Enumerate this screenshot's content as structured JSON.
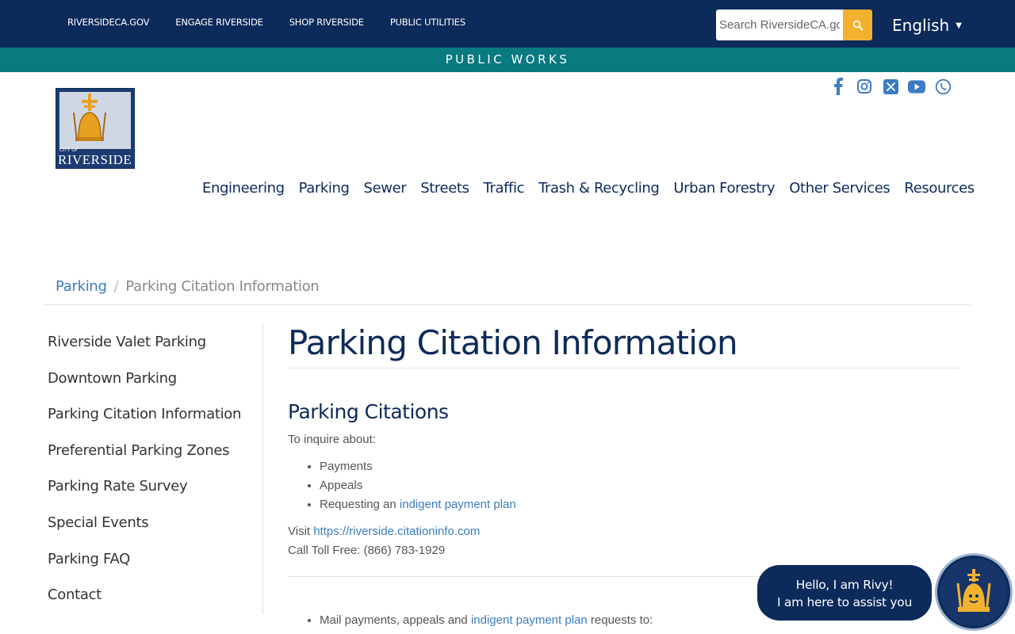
{
  "topbar": {
    "links": [
      "RIVERSIDECA.GOV",
      "ENGAGE RIVERSIDE",
      "SHOP RIVERSIDE",
      "PUBLIC UTILITIES"
    ],
    "search_placeholder": "Search RiversideCA.gov",
    "language": "English"
  },
  "dept_banner": "PUBLIC WORKS",
  "logo": {
    "line1": "CITY OF",
    "line2": "RIVERSIDE"
  },
  "social": [
    "facebook-icon",
    "instagram-icon",
    "x-icon",
    "youtube-icon",
    "phone-app-icon"
  ],
  "main_nav": [
    "Engineering",
    "Parking",
    "Sewer",
    "Streets",
    "Traffic",
    "Trash & Recycling",
    "Urban Forestry",
    "Other Services",
    "Resources"
  ],
  "breadcrumb": {
    "parent": "Parking",
    "separator": "/",
    "current": "Parking Citation Information"
  },
  "side_nav": [
    "Riverside Valet Parking",
    "Downtown Parking",
    "Parking Citation Information",
    "Preferential Parking Zones",
    "Parking Rate Survey",
    "Special Events",
    "Parking FAQ",
    "Contact"
  ],
  "content": {
    "title": "Parking Citation Information",
    "section_title": "Parking Citations",
    "intro": "To inquire about:",
    "items": [
      "Payments",
      "Appeals"
    ],
    "item3_prefix": "Requesting an ",
    "item3_link": "indigent payment plan",
    "visit_prefix": "Visit ",
    "visit_link": "https://riverside.citationinfo.com",
    "call": "Call Toll Free: (866) 783-1929",
    "mail_prefix": "Mail payments, appeals and ",
    "mail_link": "indigent payment plan",
    "mail_suffix": " requests to:"
  },
  "chat": {
    "line1": "Hello, I am Rivy!",
    "line2": "I am here to assist you"
  },
  "colors": {
    "navy": "#0c2a5a",
    "teal": "#087a80",
    "gold": "#f2b230",
    "link": "#3c7cc0"
  }
}
